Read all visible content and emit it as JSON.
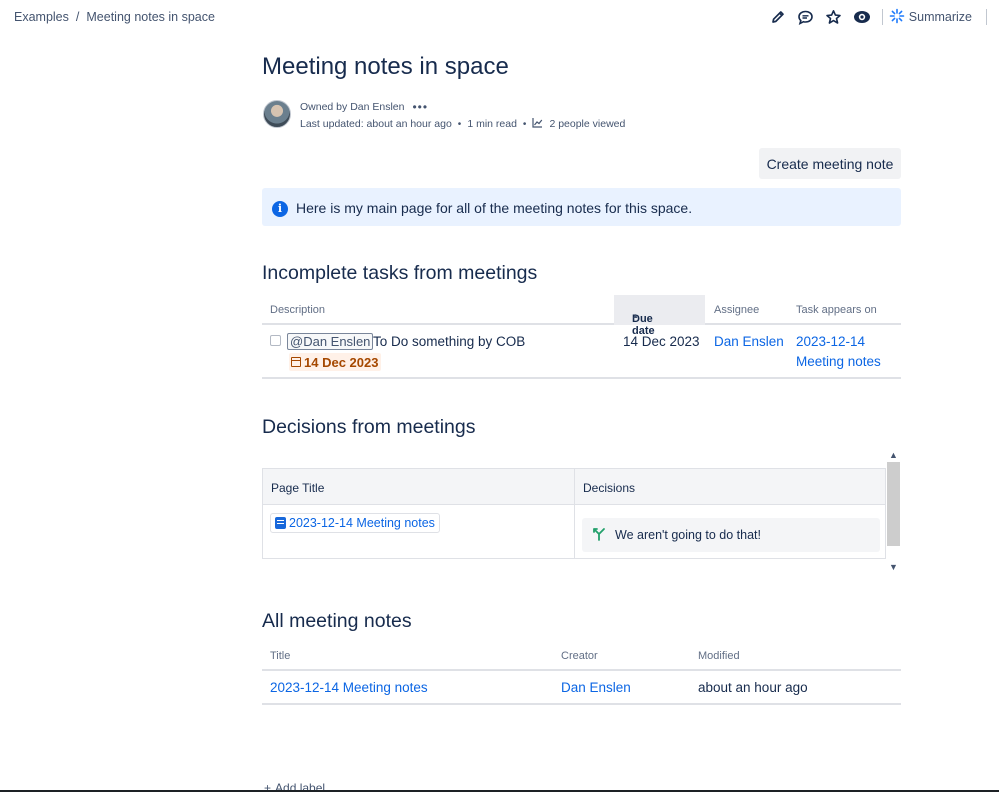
{
  "breadcrumb": {
    "items": [
      "Examples",
      "Meeting notes in space"
    ],
    "separator": "/"
  },
  "header_actions": {
    "icons": [
      "edit-pencil-icon",
      "comment-icon",
      "star-icon",
      "watch-eye-icon",
      "ai-sparkle-icon"
    ],
    "summarize_label": "Summarize"
  },
  "page": {
    "title": "Meeting notes in space",
    "owned_by": "Owned by Dan Enslen",
    "more_menu": "•••",
    "last_updated": "Last updated: about an hour ago",
    "read_time": "1 min read",
    "views": "2 people viewed",
    "bullet": "•"
  },
  "create_button": "Create meeting note",
  "info_panel": {
    "icon": "i",
    "text": "Here is my main page for all of the meeting notes for this space."
  },
  "tasks_section": {
    "heading": "Incomplete tasks from meetings",
    "columns": [
      "Description",
      "Due date",
      "Assignee",
      "Task appears on"
    ],
    "sort_indicator": "▲",
    "rows": [
      {
        "mention": "@Dan Enslen",
        "text": "To Do something by COB",
        "date_lozenge": "14 Dec 2023",
        "due_date": "14 Dec 2023",
        "assignee": "Dan Enslen",
        "appears_on_line1": "2023-12-14",
        "appears_on_line2": "Meeting notes",
        "checked": false
      }
    ]
  },
  "decisions_section": {
    "heading": "Decisions from meetings",
    "columns": [
      "Page Title",
      "Decisions"
    ],
    "rows": [
      {
        "page": "2023-12-14 Meeting notes",
        "decision": "We aren't going to do that!"
      }
    ],
    "scroll_up": "▲",
    "scroll_down": "▼"
  },
  "notes_section": {
    "heading": "All meeting notes",
    "columns": [
      "Title",
      "Creator",
      "Modified"
    ],
    "rows": [
      {
        "title": "2023-12-14 Meeting notes",
        "creator": "Dan Enslen",
        "modified": "about an hour ago"
      }
    ]
  },
  "footer": {
    "add_label": "Add label",
    "plus": "+"
  },
  "colors": {
    "link": "#0c66e4",
    "info_bg": "#e9f2ff",
    "date_lozenge": "#a54800",
    "decision_green": "#22a06b"
  }
}
